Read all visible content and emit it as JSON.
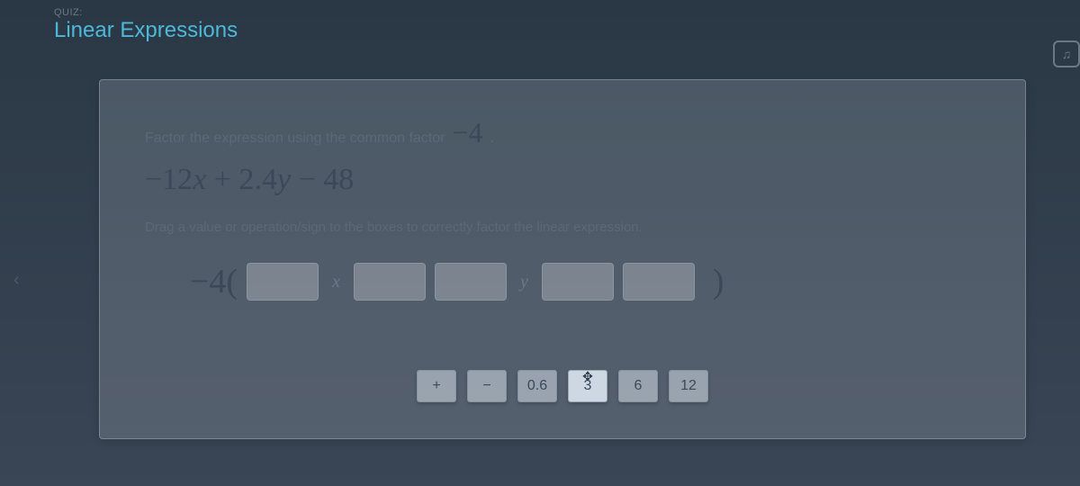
{
  "header": {
    "quiz_label": "QUIZ:",
    "topic_title": "Linear Expressions"
  },
  "question": {
    "prompt_text": "Factor the expression using the common factor",
    "factor_value": "−4",
    "period": ".",
    "expression_parts": {
      "t1": "−12",
      "v1": "x",
      "op1": " + ",
      "t2": "2.4",
      "v2": "y",
      "op2": " − ",
      "t3": "48"
    },
    "instruction": "Drag a value or operation/sign to the boxes to correctly factor the linear expression.",
    "answer_prefix": "−4(",
    "var_x": "x",
    "var_y": "y",
    "close_paren": ")"
  },
  "tiles": [
    {
      "label": "+"
    },
    {
      "label": "−"
    },
    {
      "label": "0.6"
    },
    {
      "label": "3"
    },
    {
      "label": "6"
    },
    {
      "label": "12"
    }
  ],
  "nav": {
    "prev_icon": "‹"
  },
  "badge": {
    "icon": "♫"
  }
}
